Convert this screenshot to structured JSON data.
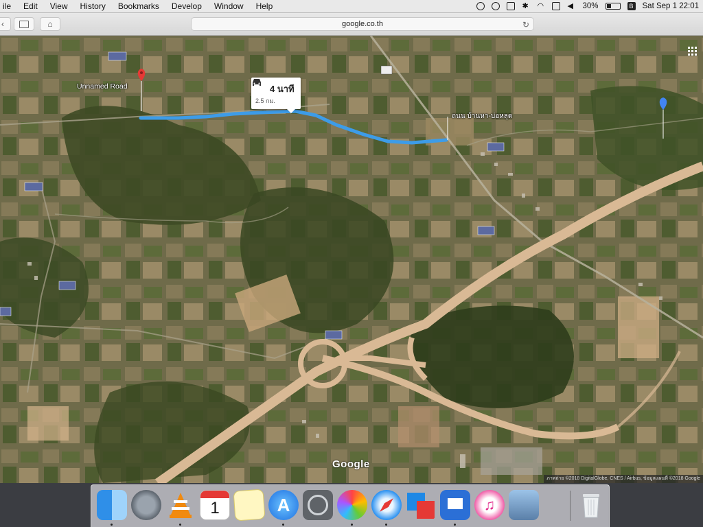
{
  "menubar": {
    "items": [
      "ile",
      "Edit",
      "View",
      "History",
      "Bookmarks",
      "Develop",
      "Window",
      "Help"
    ],
    "battery": "30%",
    "user_letter": "B",
    "clock": "Sat Sep 1  22:01"
  },
  "browser": {
    "url": "google.co.th",
    "reload_icon": "reload-icon"
  },
  "map": {
    "view": "satellite",
    "origin_label": "Unnamed Road",
    "destination_label": "ถนน บ้านหา-บ่อหลุด",
    "route": {
      "mode": "car",
      "duration": "4 นาที",
      "distance": "2.5 กม."
    },
    "logo": "Google",
    "attribution": "ภาพถ่าย ©2018 DigitalGlobe, CNES / Airbus, ข้อมูลแผนที่ ©2018 Google",
    "colors": {
      "route": "#3d9ce8",
      "origin_pin": "#e53935",
      "destination_pin": "#4285f4",
      "highway": "#d9b995"
    }
  },
  "dock": {
    "apps": [
      "Finder",
      "Launchpad",
      "VLC",
      "Calendar",
      "Notes",
      "App Store",
      "System Preferences",
      "Photos",
      "Safari",
      "Parallels",
      "Keynote",
      "iTunes",
      "Preview",
      "Trash"
    ],
    "calendar_day": "1"
  }
}
